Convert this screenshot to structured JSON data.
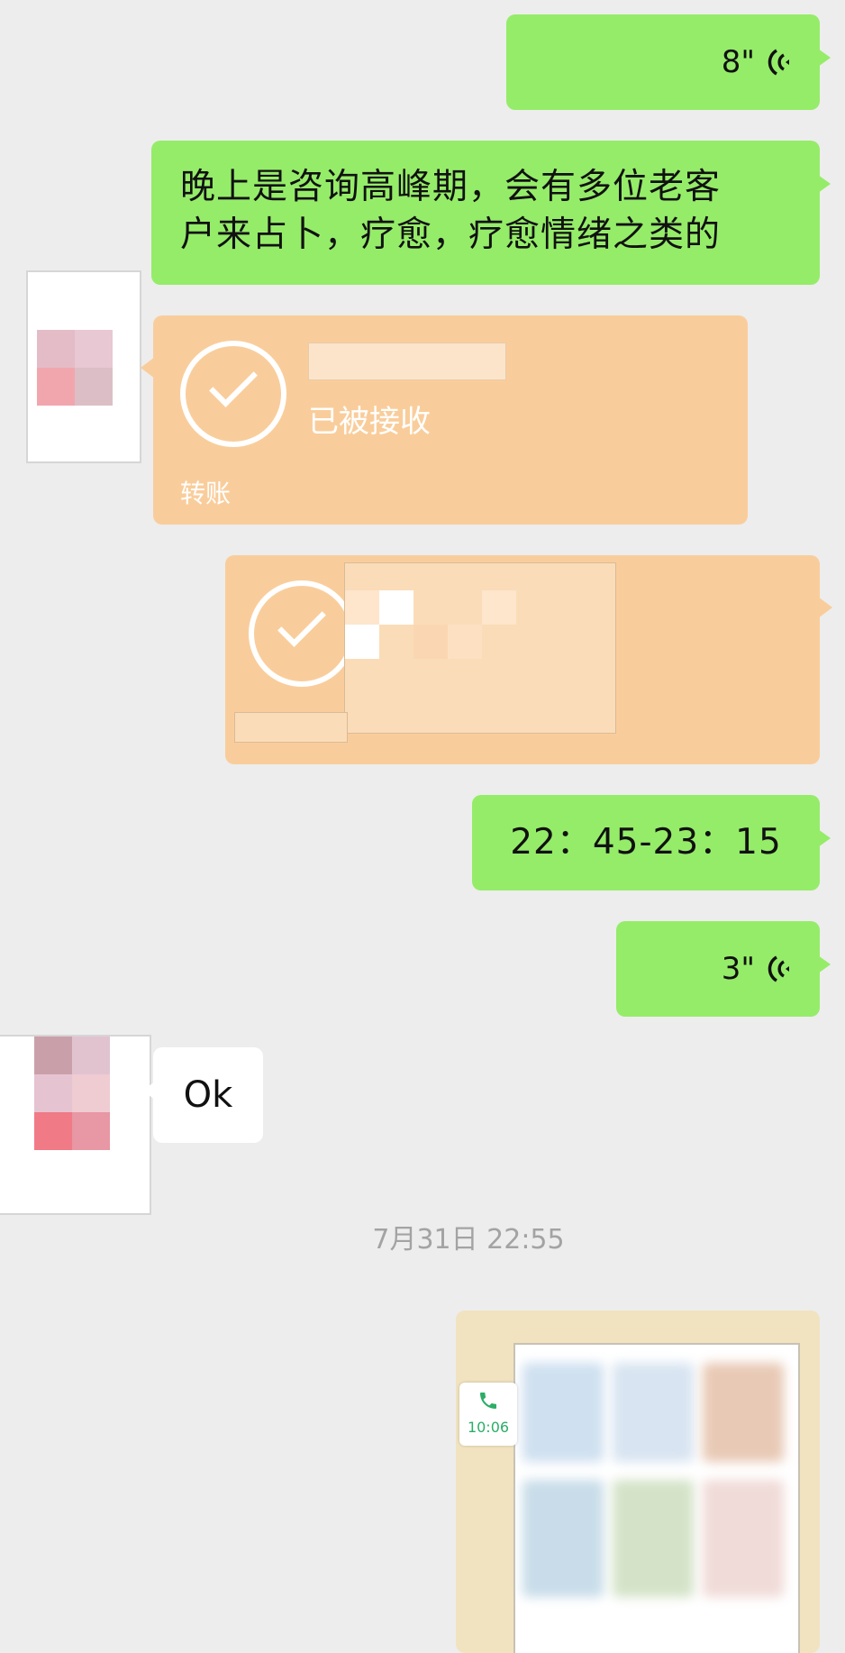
{
  "messages": {
    "voice1": {
      "duration": "8\""
    },
    "text1": {
      "line1": "晚上是咨询高峰期，会有多位老客",
      "line2": "户来占卜，疗愈，疗愈情绪之类的"
    },
    "transfer1": {
      "status": "已被接收",
      "label": "转账"
    },
    "text2": {
      "content": "22：45-23：15"
    },
    "voice2": {
      "duration": "3\""
    },
    "reply": {
      "content": "Ok"
    },
    "timestamp": "7月31日 22:55",
    "call_card": {
      "time": "10:06"
    }
  },
  "colors": {
    "bubble_green": "#95ec69",
    "transfer_orange": "#f9cd9b",
    "background": "#ededed"
  },
  "icons": [
    "voice-icon",
    "check-icon",
    "phone-icon"
  ]
}
